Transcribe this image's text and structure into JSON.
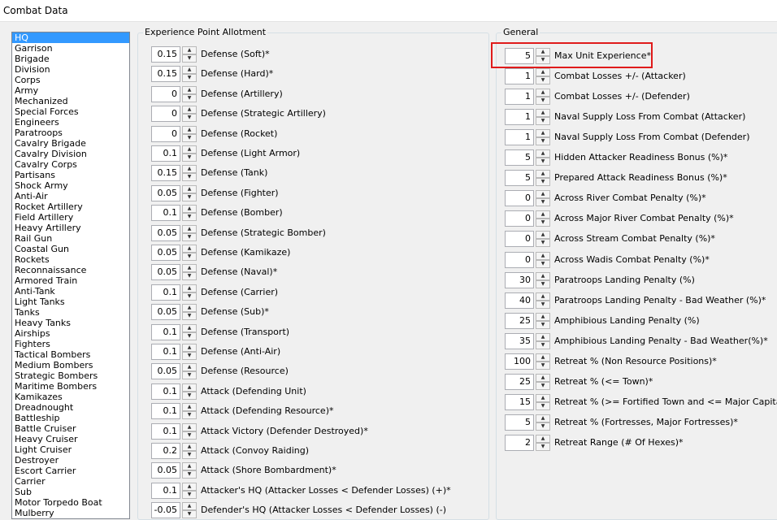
{
  "window": {
    "title": "Combat Data"
  },
  "unit_list": {
    "items": [
      "HQ",
      "Garrison",
      "Brigade",
      "Division",
      "Corps",
      "Army",
      "Mechanized",
      "Special Forces",
      "Engineers",
      "Paratroops",
      "Cavalry Brigade",
      "Cavalry Division",
      "Cavalry Corps",
      "Partisans",
      "Shock Army",
      "Anti-Air",
      "Rocket Artillery",
      "Field Artillery",
      "Heavy Artillery",
      "Rail Gun",
      "Coastal Gun",
      "Rockets",
      "Reconnaissance",
      "Armored Train",
      "Anti-Tank",
      "Light Tanks",
      "Tanks",
      "Heavy Tanks",
      "Airships",
      "Fighters",
      "Tactical Bombers",
      "Medium Bombers",
      "Strategic Bombers",
      "Maritime Bombers",
      "Kamikazes",
      "Dreadnought",
      "Battleship",
      "Battle Cruiser",
      "Heavy Cruiser",
      "Light Cruiser",
      "Destroyer",
      "Escort Carrier",
      "Carrier",
      "Sub",
      "Motor Torpedo Boat",
      "Mulberry"
    ],
    "selected": "HQ"
  },
  "experience": {
    "label": "Experience Point Allotment",
    "rows": [
      {
        "value": "0.15",
        "label": "Defense (Soft)*"
      },
      {
        "value": "0.15",
        "label": "Defense (Hard)*"
      },
      {
        "value": "0",
        "label": "Defense (Artillery)"
      },
      {
        "value": "0",
        "label": "Defense (Strategic Artillery)"
      },
      {
        "value": "0",
        "label": "Defense (Rocket)"
      },
      {
        "value": "0.1",
        "label": "Defense (Light Armor)"
      },
      {
        "value": "0.15",
        "label": "Defense (Tank)"
      },
      {
        "value": "0.05",
        "label": "Defense (Fighter)"
      },
      {
        "value": "0.1",
        "label": "Defense (Bomber)"
      },
      {
        "value": "0.05",
        "label": "Defense (Strategic Bomber)"
      },
      {
        "value": "0.05",
        "label": "Defense (Kamikaze)"
      },
      {
        "value": "0.05",
        "label": "Defense (Naval)*"
      },
      {
        "value": "0.1",
        "label": "Defense (Carrier)"
      },
      {
        "value": "0.05",
        "label": "Defense (Sub)*"
      },
      {
        "value": "0.1",
        "label": "Defense (Transport)"
      },
      {
        "value": "0.1",
        "label": "Defense (Anti-Air)"
      },
      {
        "value": "0.05",
        "label": "Defense (Resource)"
      },
      {
        "value": "0.1",
        "label": "Attack (Defending Unit)"
      },
      {
        "value": "0.1",
        "label": "Attack (Defending Resource)*"
      },
      {
        "value": "0.1",
        "label": "Attack Victory (Defender Destroyed)*"
      },
      {
        "value": "0.2",
        "label": "Attack (Convoy Raiding)"
      },
      {
        "value": "0.05",
        "label": "Attack (Shore Bombardment)*"
      },
      {
        "value": "0.1",
        "label": "Attacker's HQ (Attacker Losses < Defender Losses) (+)*"
      },
      {
        "value": "-0.05",
        "label": "Defender's HQ (Attacker Losses < Defender Losses) (-)"
      }
    ]
  },
  "general": {
    "label": "General",
    "rows": [
      {
        "value": "5",
        "label": "Max Unit Experience*"
      },
      {
        "value": "1",
        "label": "Combat Losses +/- (Attacker)"
      },
      {
        "value": "1",
        "label": "Combat Losses +/- (Defender)"
      },
      {
        "value": "1",
        "label": "Naval Supply Loss From Combat (Attacker)"
      },
      {
        "value": "1",
        "label": "Naval Supply Loss From Combat (Defender)"
      },
      {
        "value": "5",
        "label": "Hidden Attacker Readiness Bonus (%)*"
      },
      {
        "value": "5",
        "label": "Prepared Attack Readiness Bonus (%)*"
      },
      {
        "value": "0",
        "label": "Across River Combat Penalty (%)*"
      },
      {
        "value": "0",
        "label": "Across Major River Combat Penalty (%)*"
      },
      {
        "value": "0",
        "label": "Across Stream Combat Penalty (%)*"
      },
      {
        "value": "0",
        "label": "Across Wadis Combat Penalty (%)*"
      },
      {
        "value": "30",
        "label": "Paratroops Landing Penalty (%)"
      },
      {
        "value": "40",
        "label": "Paratroops Landing Penalty - Bad Weather (%)*"
      },
      {
        "value": "25",
        "label": "Amphibious Landing Penalty (%)"
      },
      {
        "value": "35",
        "label": "Amphibious Landing Penalty - Bad Weather(%)*"
      },
      {
        "value": "100",
        "label": "Retreat % (Non Resource Positions)*"
      },
      {
        "value": "25",
        "label": "Retreat % (<= Town)*"
      },
      {
        "value": "15",
        "label": "Retreat % (>= Fortified Town and <= Major Capital)*"
      },
      {
        "value": "5",
        "label": "Retreat % (Fortresses, Major Fortresses)*"
      },
      {
        "value": "2",
        "label": "Retreat Range (# Of Hexes)*"
      }
    ]
  },
  "colors": {
    "selection": "#3399ff",
    "highlight_box": "#e01b1b"
  },
  "icons": {
    "spin_up": "caret-up-icon",
    "spin_down": "caret-down-icon"
  }
}
